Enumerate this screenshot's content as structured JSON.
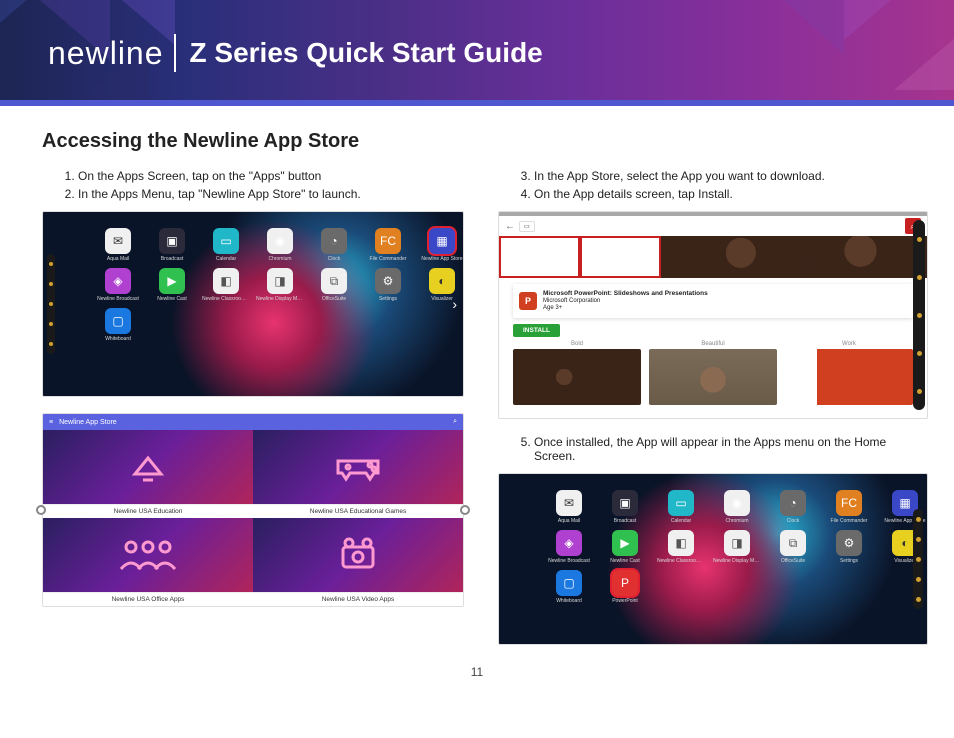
{
  "header": {
    "brand": "newline",
    "docTitle": "Z Series Quick Start Guide"
  },
  "section": {
    "title": "Accessing the Newline App Store"
  },
  "col1": {
    "steps": [
      "On the Apps Screen, tap on the \"Apps\" button",
      "In the Apps Menu, tap \"Newline App Store\" to launch."
    ],
    "shot1": {
      "apps_r1": [
        "Aqua Mail",
        "Broadcast",
        "Calendar",
        "Chromium",
        "Clock",
        "File Commander",
        "Newline App Store"
      ],
      "apps_r2": [
        "Newline Broadcast",
        "Newline Cast",
        "Newline Classroom Tools",
        "Newline Display Manager",
        "OfficeSuite",
        "Settings",
        "Visualizer"
      ],
      "apps_r3": [
        "Whiteboard"
      ]
    },
    "shot2": {
      "headerTitle": "Newline App Store",
      "cats": [
        "Newline USA Education",
        "Newline USA Educational Games",
        "Newline USA Office Apps",
        "Newline USA Video Apps"
      ]
    }
  },
  "col2": {
    "stepsA": [
      "In the App Store, select the App you want to download.",
      "On the App details screen, tap Install."
    ],
    "shot3": {
      "appTitle": "Microsoft PowerPoint: Slideshows and Presentations",
      "publisher": "Microsoft Corporation",
      "age": "Age 3+",
      "installLabel": "INSTALL",
      "galleryLabels": [
        "Bold",
        "Beautiful",
        "Work"
      ]
    },
    "stepsB": [
      "Once installed, the App will appear in the Apps menu on the Home Screen."
    ],
    "shot4": {
      "apps_r1": [
        "Aqua Mail",
        "Broadcast",
        "Calendar",
        "Chromium",
        "Clock",
        "File Commander",
        "Newline App Store"
      ],
      "apps_r2": [
        "Newline Broadcast",
        "Newline Cast",
        "Newline Classroom Tools",
        "Newline Display Manager",
        "OfficeSuite",
        "Settings",
        "Visualizer"
      ],
      "apps_r3": [
        "Whiteboard",
        "PowerPoint"
      ]
    }
  },
  "pageNumber": "11"
}
